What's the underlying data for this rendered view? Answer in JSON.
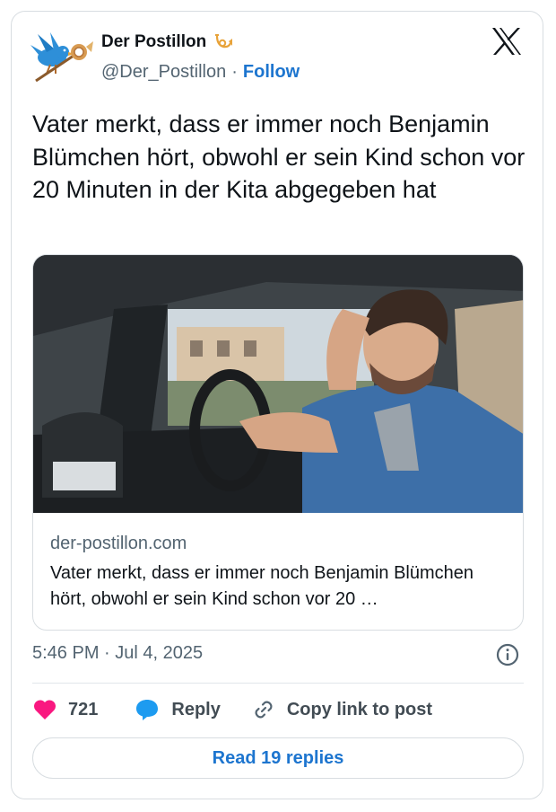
{
  "author": {
    "name": "Der Postillon",
    "handle": "@Der_Postillon",
    "separator": "·",
    "follow_label": "Follow"
  },
  "tweet": {
    "text": "Vater merkt, dass er immer noch Benjamin Blümchen hört, obwohl er sein Kind schon vor 20 Minuten in der Kita abgegeben hat"
  },
  "link_card": {
    "domain": "der-postillon.com",
    "title": "Vater merkt, dass er immer noch Benjamin Blümchen hört, obwohl er sein Kind schon vor 20 …",
    "image": "man-driving-car-hand-on-forehead-photo"
  },
  "meta": {
    "timestamp": "5:46 PM · Jul 4, 2025"
  },
  "actions": {
    "likes_count": "721",
    "reply_label": "Reply",
    "copy_link_label": "Copy link to post"
  },
  "read_replies_label": "Read 19 replies",
  "icons": {
    "like": "heart-icon",
    "reply": "speech-bubble-icon",
    "copy": "link-icon",
    "info": "info-icon",
    "platform": "x-logo-icon"
  },
  "colors": {
    "accent": "#1d75cf",
    "like": "#f91880",
    "reply_icon": "#1d9bf0",
    "secondary_text": "#536471"
  }
}
